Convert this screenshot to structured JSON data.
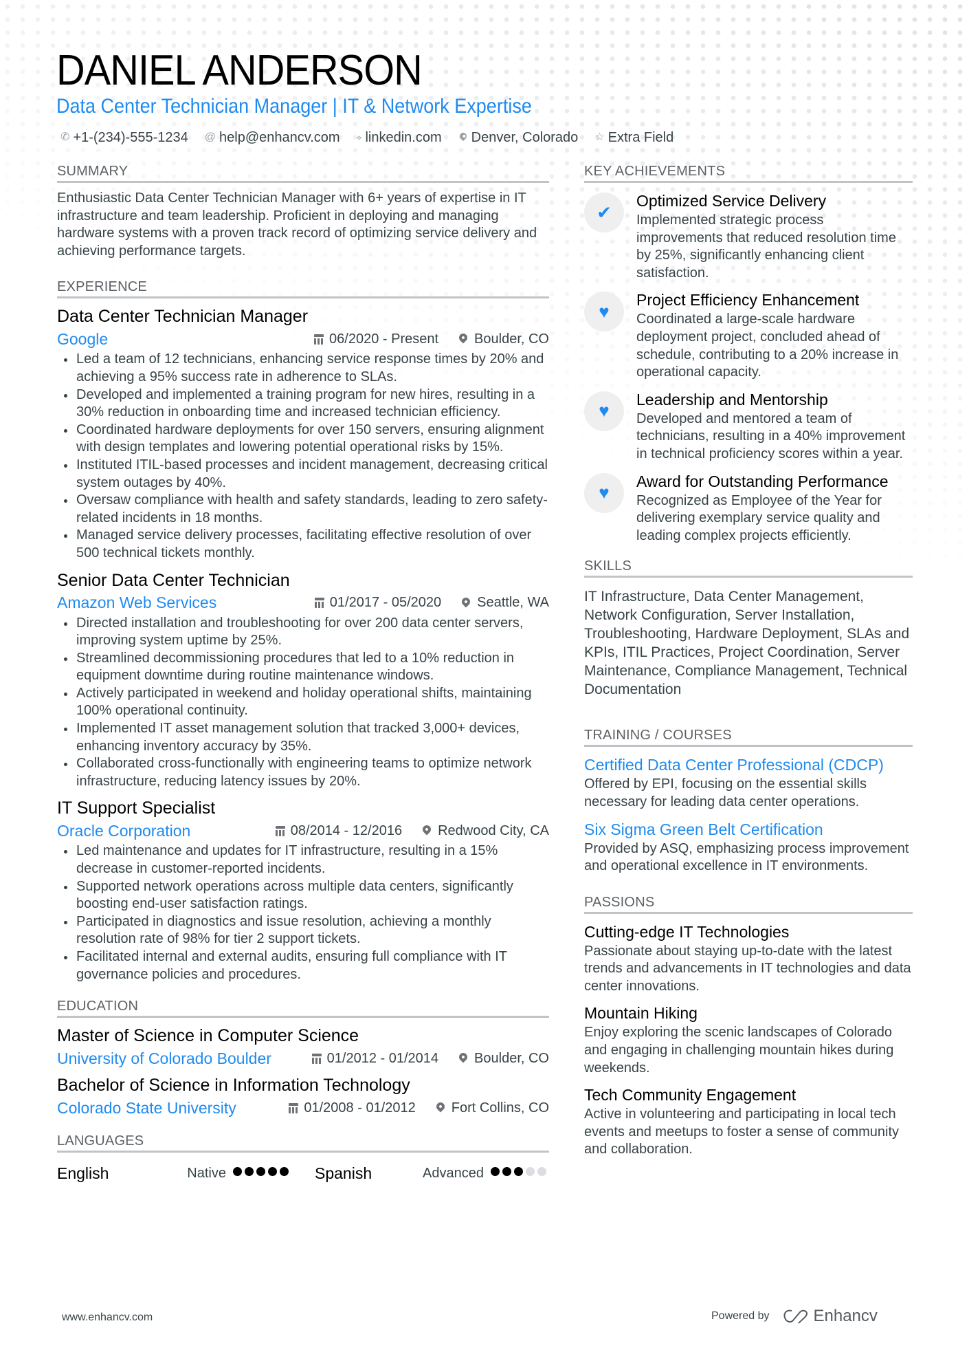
{
  "header": {
    "name": "DANIEL ANDERSON",
    "title": "Data Center Technician Manager | IT & Network Expertise",
    "contacts": [
      {
        "icon": "phone-icon",
        "glyph": "✆",
        "text": "+1-(234)-555-1234"
      },
      {
        "icon": "at-icon",
        "glyph": "@",
        "text": "help@enhancv.com"
      },
      {
        "icon": "link-icon",
        "glyph": "🔗",
        "text": "linkedin.com"
      },
      {
        "icon": "location-icon",
        "glyph": "●",
        "text": "Denver, Colorado"
      },
      {
        "icon": "star-icon",
        "glyph": "☆",
        "text": "Extra Field"
      }
    ]
  },
  "summary": {
    "heading": "SUMMARY",
    "text": "Enthusiastic Data Center Technician Manager with 6+ years of expertise in IT infrastructure and team leadership. Proficient in deploying and managing hardware systems with a proven track record of optimizing service delivery and achieving performance targets."
  },
  "experience": {
    "heading": "EXPERIENCE",
    "jobs": [
      {
        "title": "Data Center Technician Manager",
        "company": "Google",
        "dates": "06/2020 - Present",
        "location": "Boulder, CO",
        "bullets": [
          "Led a team of 12 technicians, enhancing service response times by 20% and achieving a 95% success rate in adherence to SLAs.",
          "Developed and implemented a training program for new hires, resulting in a 30% reduction in onboarding time and increased technician efficiency.",
          "Coordinated hardware deployments for over 150 servers, ensuring alignment with design templates and lowering potential operational risks by 15%.",
          "Instituted ITIL-based processes and incident management, decreasing critical system outages by 40%.",
          "Oversaw compliance with health and safety standards, leading to zero safety-related incidents in 18 months.",
          "Managed service delivery processes, facilitating effective resolution of over 500 technical tickets monthly."
        ]
      },
      {
        "title": "Senior Data Center Technician",
        "company": "Amazon Web Services",
        "dates": "01/2017 - 05/2020",
        "location": "Seattle, WA",
        "bullets": [
          "Directed installation and troubleshooting for over 200 data center servers, improving system uptime by 25%.",
          "Streamlined decommissioning procedures that led to a 10% reduction in equipment downtime during routine maintenance windows.",
          "Actively participated in weekend and holiday operational shifts, maintaining 100% operational continuity.",
          "Implemented IT asset management solution that tracked 3,000+ devices, enhancing inventory accuracy by 35%.",
          "Collaborated cross-functionally with engineering teams to optimize network infrastructure, reducing latency issues by 20%."
        ]
      },
      {
        "title": "IT Support Specialist",
        "company": "Oracle Corporation",
        "dates": "08/2014 - 12/2016",
        "location": "Redwood City, CA",
        "bullets": [
          "Led maintenance and updates for IT infrastructure, resulting in a 15% decrease in customer-reported incidents.",
          "Supported network operations across multiple data centers, significantly boosting end-user satisfaction ratings.",
          "Participated in diagnostics and issue resolution, achieving a monthly resolution rate of 98% for tier 2 support tickets.",
          "Facilitated internal and external audits, ensuring full compliance with IT governance policies and procedures."
        ]
      }
    ]
  },
  "education": {
    "heading": "EDUCATION",
    "items": [
      {
        "degree": "Master of Science in Computer Science",
        "school": "University of Colorado Boulder",
        "dates": "01/2012 - 01/2014",
        "location": "Boulder, CO"
      },
      {
        "degree": "Bachelor of Science in Information Technology",
        "school": "Colorado State University",
        "dates": "01/2008 - 01/2012",
        "location": "Fort Collins, CO"
      }
    ]
  },
  "languages": {
    "heading": "LANGUAGES",
    "items": [
      {
        "name": "English",
        "level": "Native",
        "rating": 5,
        "max": 5
      },
      {
        "name": "Spanish",
        "level": "Advanced",
        "rating": 3,
        "max": 5
      }
    ]
  },
  "achievements": {
    "heading": "KEY ACHIEVEMENTS",
    "items": [
      {
        "icon": "check-icon",
        "glyph": "✔",
        "title": "Optimized Service Delivery",
        "desc": "Implemented strategic process improvements that reduced resolution time by 25%, significantly enhancing client satisfaction."
      },
      {
        "icon": "heart-icon",
        "glyph": "♥",
        "title": "Project Efficiency Enhancement",
        "desc": "Coordinated a large-scale hardware deployment project, concluded ahead of schedule, contributing to a 20% increase in operational capacity."
      },
      {
        "icon": "heart-icon",
        "glyph": "♥",
        "title": "Leadership and Mentorship",
        "desc": "Developed and mentored a team of technicians, resulting in a 40% improvement in technical proficiency scores within a year."
      },
      {
        "icon": "heart-icon",
        "glyph": "♥",
        "title": "Award for Outstanding Performance",
        "desc": "Recognized as Employee of the Year for delivering exemplary service quality and leading complex projects efficiently."
      }
    ]
  },
  "skills": {
    "heading": "SKILLS",
    "text": "IT Infrastructure, Data Center Management, Network Configuration, Server Installation, Troubleshooting, Hardware Deployment, SLAs and KPIs, ITIL Practices, Project Coordination, Server Maintenance, Compliance Management, Technical Documentation"
  },
  "training": {
    "heading": "TRAINING / COURSES",
    "items": [
      {
        "title": "Certified Data Center Professional (CDCP)",
        "desc": "Offered by EPI, focusing on the essential skills necessary for leading data center operations."
      },
      {
        "title": "Six Sigma Green Belt Certification",
        "desc": "Provided by ASQ, emphasizing process improvement and operational excellence in IT environments."
      }
    ]
  },
  "passions": {
    "heading": "PASSIONS",
    "items": [
      {
        "title": "Cutting-edge IT Technologies",
        "desc": "Passionate about staying up-to-date with the latest trends and advancements in IT technologies and data center innovations."
      },
      {
        "title": "Mountain Hiking",
        "desc": "Enjoy exploring the scenic landscapes of Colorado and engaging in challenging mountain hikes during weekends."
      },
      {
        "title": "Tech Community Engagement",
        "desc": "Active in volunteering and participating in local tech events and meetups to foster a sense of community and collaboration."
      }
    ]
  },
  "footer": {
    "website": "www.enhancv.com",
    "powered_by": "Powered by",
    "brand": "Enhancv"
  },
  "colors": {
    "accent": "#1e8bf0",
    "text": "#384347",
    "heading_rule": "#c1c3c6"
  }
}
